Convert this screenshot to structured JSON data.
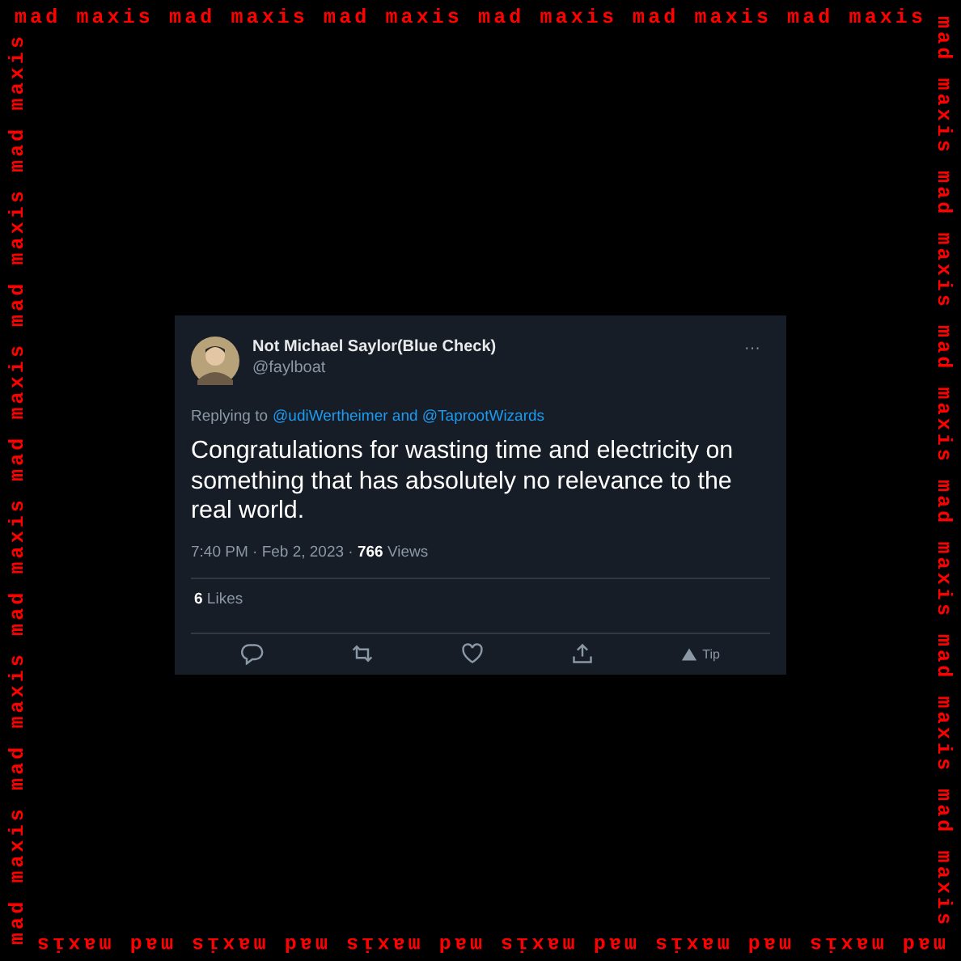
{
  "frame": {
    "top": "mad maxis mad maxis mad maxis mad maxis mad maxis mad maxis",
    "right": "mad maxis mad maxis mad maxis mad maxis mad maxis mad maxis",
    "bottom": "mad maxis mad maxis mad maxis mad maxis mad maxis mad maxis",
    "left": "mad maxis mad maxis mad maxis mad maxis mad maxis mad maxis"
  },
  "tweet": {
    "author": "Not Michael Saylor(Blue Check)",
    "handle": "@faylboat",
    "more": "···",
    "replying_prefix": "Replying to",
    "replying_to": "@udiWertheimer and @TaprootWizards",
    "text": "Congratulations for wasting time and electricity on something that has absolutely no relevance to the real world.",
    "time": "7:40 PM · Feb 2, 2023 · ",
    "views_count": "766",
    "views_label": " Views",
    "likes_count": "6",
    "likes_label": " Likes",
    "actions": [
      {
        "kind": "reply"
      },
      {
        "kind": "retweet"
      },
      {
        "kind": "like"
      },
      {
        "kind": "share"
      },
      {
        "kind": "tip",
        "label": "Tip"
      }
    ]
  }
}
